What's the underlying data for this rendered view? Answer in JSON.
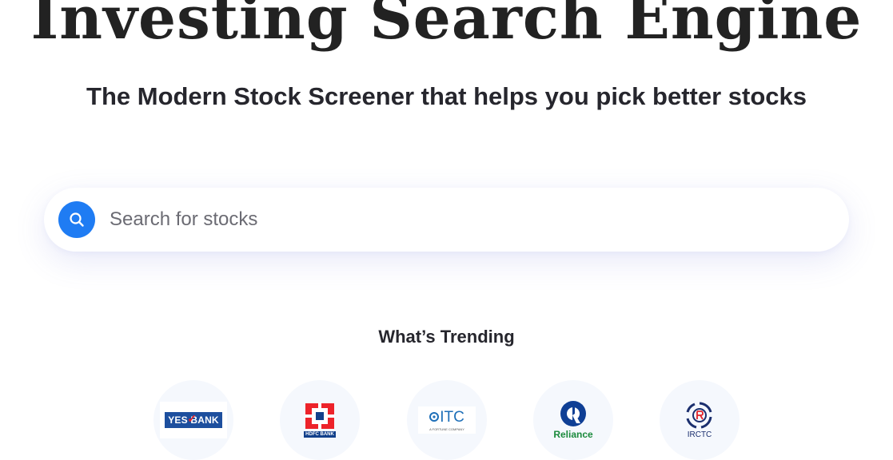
{
  "hero": {
    "title": "Investing Search Engine",
    "subtitle": "The Modern Stock Screener that helps you pick better stocks"
  },
  "search": {
    "placeholder": "Search for stocks",
    "button_icon": "search-icon",
    "value": ""
  },
  "trending": {
    "title": "What’s Trending",
    "items": [
      {
        "name": "YES BANK",
        "logo_text": "YES BANK"
      },
      {
        "name": "HDFC BANK",
        "logo_text": "HDFC BANK"
      },
      {
        "name": "ITC",
        "logo_text": "ITC",
        "tagline": "A FORTUNE COMPANY"
      },
      {
        "name": "Reliance",
        "logo_text": "Reliance"
      },
      {
        "name": "IRCTC",
        "logo_text": "IRCTC"
      }
    ]
  },
  "colors": {
    "accent": "#1f7cf3",
    "title_text": "#222222",
    "trend_bg": "#f5f8fd"
  }
}
